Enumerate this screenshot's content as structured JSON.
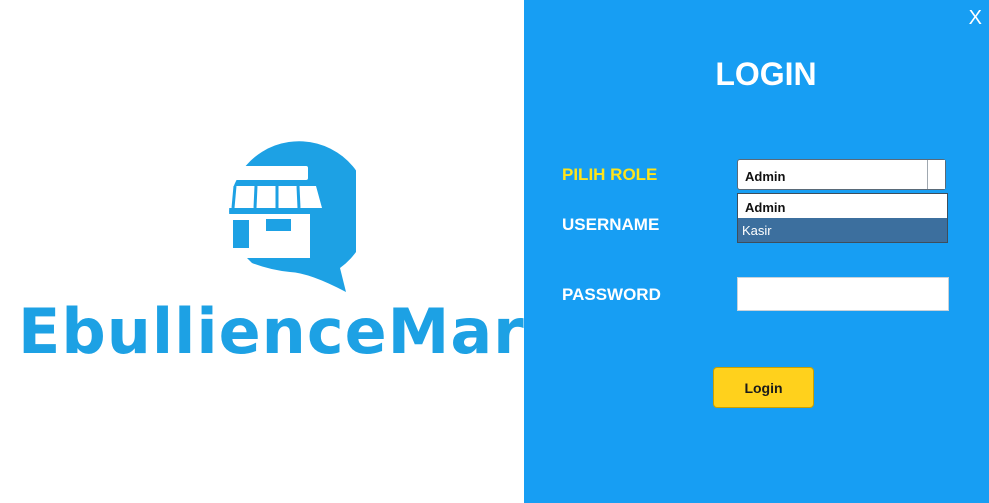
{
  "brand": {
    "name": "EbullienceMart",
    "logo_icon": "store-awning-icon",
    "color": "#1da1e4"
  },
  "login": {
    "close_label": "X",
    "title": "LOGIN",
    "role_label": "PILIH ROLE",
    "username_label": "USERNAME",
    "password_label": "PASSWORD",
    "role_selected": "Admin",
    "role_options": [
      {
        "label": "Admin"
      },
      {
        "label": "Kasir"
      }
    ],
    "password_value": "",
    "submit_label": "Login"
  },
  "colors": {
    "panel_bg": "#179ef3",
    "accent_yellow": "#ffd11c",
    "highlight_row": "#3c6f9e"
  }
}
